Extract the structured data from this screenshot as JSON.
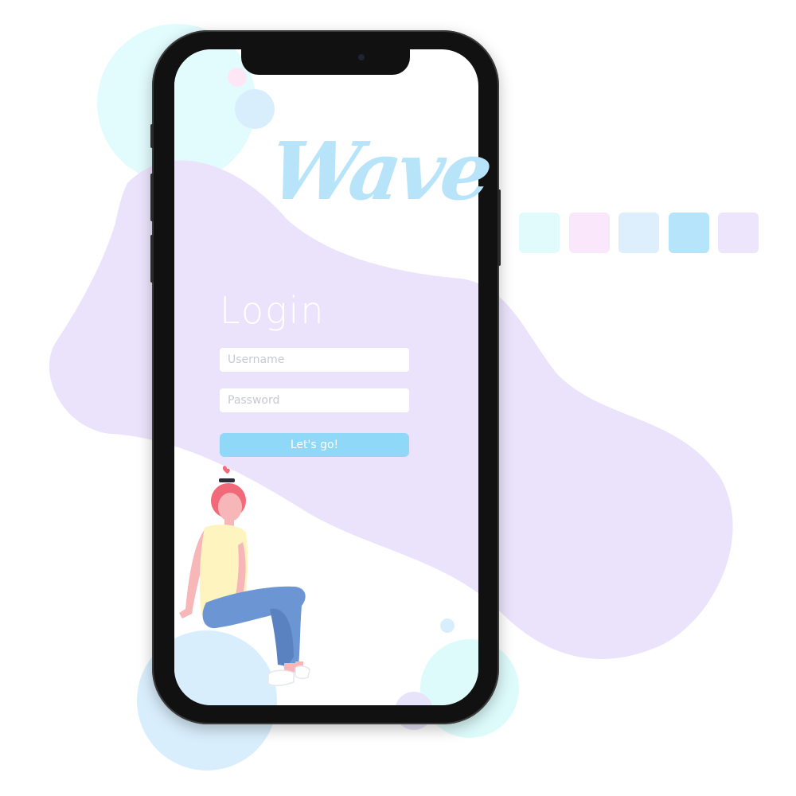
{
  "app": {
    "logo_text": "Wave"
  },
  "login": {
    "title": "Login",
    "username_placeholder": "Username",
    "password_placeholder": "Password",
    "submit_label": "Let's go!"
  },
  "palette": {
    "colors": [
      "#e1fbfc",
      "#fbe7fb",
      "#ddeefc",
      "#b6e4fb",
      "#ece5fb"
    ]
  },
  "colors": {
    "blob": "#ebe3fb",
    "button": "#8fd8f7",
    "logo": "#b8e4fa",
    "circle_cyan": "#e2fbfd",
    "circle_blue": "#d9eefc",
    "circle_pink": "#fde7f7",
    "phone_frame": "#111111"
  },
  "icons": {
    "illustration": "sitting-woman-illustration"
  }
}
